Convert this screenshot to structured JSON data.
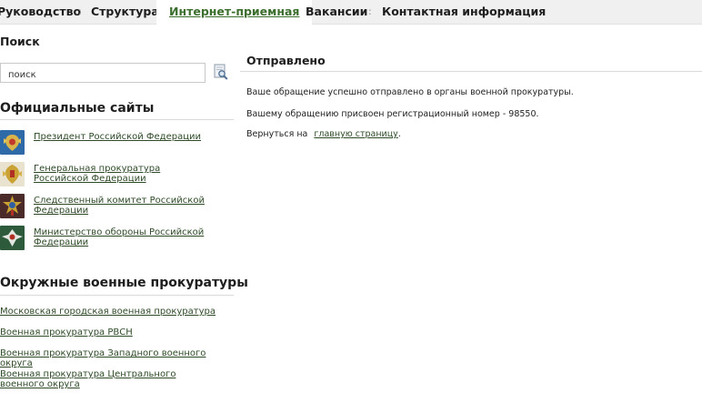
{
  "nav": {
    "items": [
      {
        "label": "Руководство"
      },
      {
        "label": "Структура"
      },
      {
        "label": "Интернет-приемная"
      },
      {
        "label": "Вакансии"
      },
      {
        "label": "Контактная информация"
      }
    ],
    "separator": ":"
  },
  "sidebar": {
    "search": {
      "heading": "Поиск",
      "value": "поиск",
      "button_icon": "search-icon"
    },
    "official_sites": {
      "heading": "Официальные сайты",
      "items": [
        {
          "label": "Президент Российской Федерации",
          "icon": "president-emblem-icon"
        },
        {
          "label": "Генеральная прокуратура Российской Федерации",
          "icon": "prosecutor-emblem-icon"
        },
        {
          "label": "Следственный комитет Российской Федерации",
          "icon": "investigative-committee-emblem-icon"
        },
        {
          "label": "Министерство обороны Российской Федерации",
          "icon": "defense-ministry-emblem-icon"
        }
      ]
    },
    "district": {
      "heading": "Окружные военные прокуратуры",
      "items": [
        {
          "label": "Московская городская военная прокуратура"
        },
        {
          "label": "Военная прокуратура РВСН"
        },
        {
          "label": "Военная прокуратура Западного военного округа"
        },
        {
          "label": "Военная прокуратура Центрального военного округа"
        }
      ]
    }
  },
  "main": {
    "title": "Отправлено",
    "line1": "Ваше обращение успешно отправлено в органы военной прокуратуры.",
    "line2": "Вашему обращению присвоен регистрационный номер - 98550.",
    "line3_prefix": "Вернуться на",
    "line3_link": "главную страницу",
    "line3_suffix": "."
  },
  "colors": {
    "accent_green": "#3c6e2e",
    "link_green": "#2e4a27",
    "nav_bg": "#f0f0f0"
  }
}
